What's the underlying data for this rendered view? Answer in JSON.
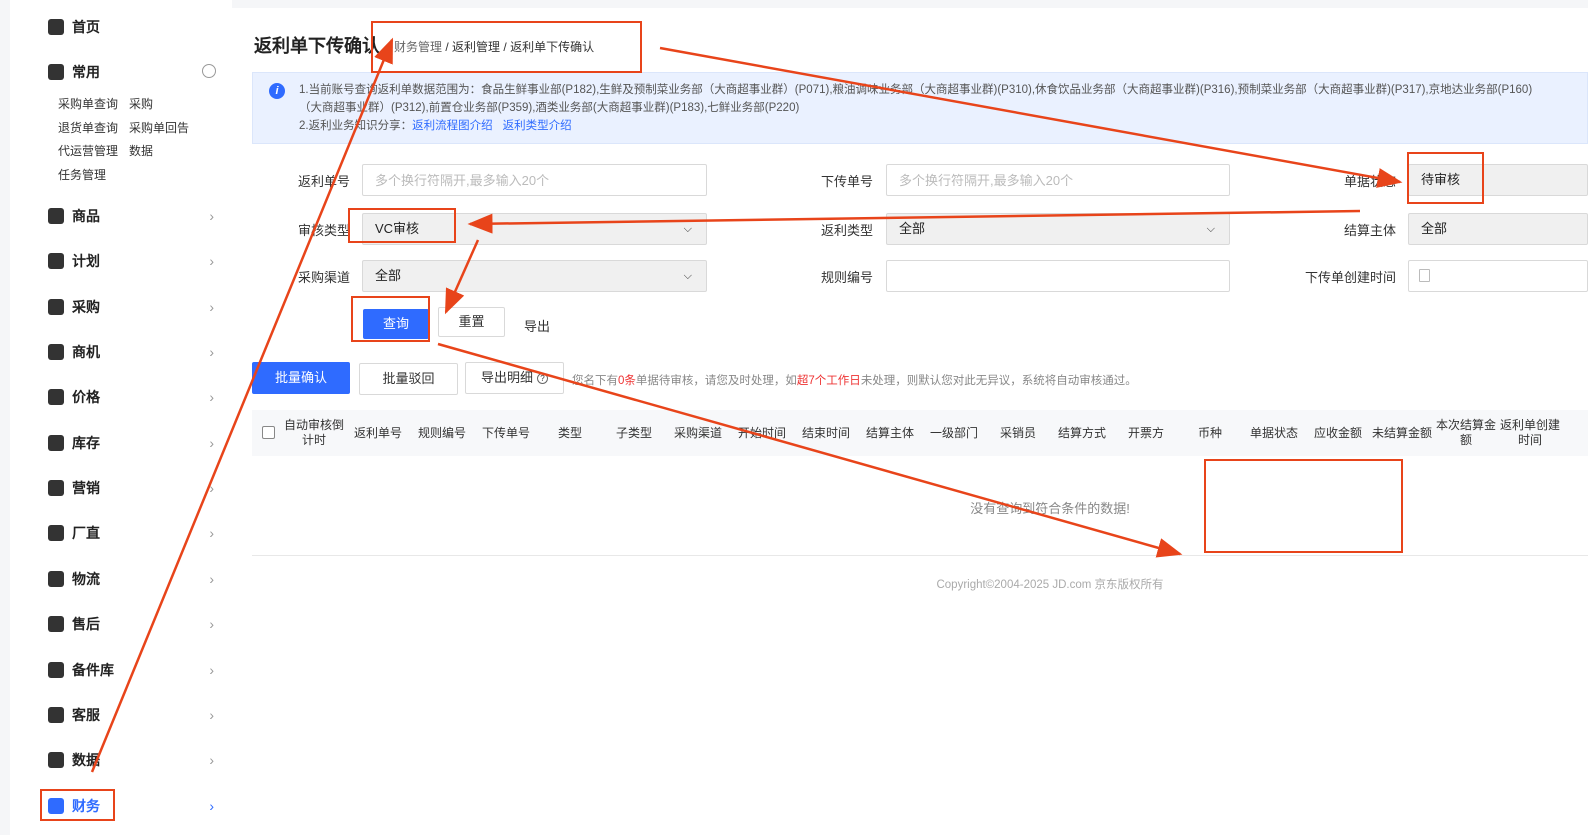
{
  "sidebar": {
    "home": "首页",
    "common": "常用",
    "quick_links": [
      "采购单查询",
      "采购",
      "退货单查询",
      "采购单回告",
      "代运营管理",
      "数据",
      "任务管理"
    ],
    "items": [
      "商品",
      "计划",
      "采购",
      "商机",
      "价格",
      "库存",
      "营销",
      "厂直",
      "物流",
      "售后",
      "备件库",
      "客服",
      "数据",
      "财务"
    ],
    "active": "财务"
  },
  "page": {
    "title": "返利单下传确认",
    "breadcrumb": [
      "财务管理",
      "返利管理",
      "返利单下传确认"
    ]
  },
  "notice": {
    "line1a": "1.当前账号查询返利单数据范围为：食品生鲜事业部(P182),生鲜及预制菜业务部（大商超事业群）(P071),粮油调味业务部（大商超事业群)(P310),休食饮品业务部（大商超事业群)(P316),预制菜业务部（大商超事业群)(P317),京地达业务部(P160)",
    "line1b": "（大商超事业群）(P312),前置仓业务部(P359),酒类业务部(大商超事业群)(P183),七鲜业务部(P220)",
    "line2": "2.返利业务知识分享：",
    "link1": "返利流程图介绍",
    "link2": "返利类型介绍"
  },
  "filters": {
    "rebate_no": {
      "label": "返利单号",
      "placeholder": "多个换行符隔开,最多输入20个"
    },
    "upload_no": {
      "label": "下传单号",
      "placeholder": "多个换行符隔开,最多输入20个"
    },
    "doc_status": {
      "label": "单据状态",
      "value": "待审核"
    },
    "audit_type": {
      "label": "审核类型",
      "value": "VC审核"
    },
    "rebate_type": {
      "label": "返利类型",
      "value": "全部"
    },
    "settle_entity": {
      "label": "结算主体",
      "value": "全部"
    },
    "purchase_channel": {
      "label": "采购渠道",
      "value": "全部"
    },
    "rule_no": {
      "label": "规则编号",
      "value": ""
    },
    "created_time": {
      "label": "下传单创建时间"
    }
  },
  "actions": {
    "query": "查询",
    "reset": "重置",
    "export": "导出"
  },
  "batch": {
    "confirm": "批量确认",
    "reject": "批量驳回",
    "export_detail": "导出明细"
  },
  "hint": {
    "p1": "您名下有",
    "count": "0条",
    "p2": "单据待审核，请您及时处理，如",
    "deadline": "超7个工作日",
    "p3": "未处理，则默认您对此无异议，系统将自动审核通过。"
  },
  "table": {
    "columns": [
      "自动审核倒计时",
      "返利单号",
      "规则编号",
      "下传单号",
      "类型",
      "子类型",
      "采购渠道",
      "开始时间",
      "结束时间",
      "结算主体",
      "一级部门",
      "采销员",
      "结算方式",
      "开票方",
      "币种",
      "单据状态",
      "应收金额",
      "未结算金额",
      "本次结算金额",
      "返利单创建时间"
    ],
    "empty": "没有查询到符合条件的数据!"
  },
  "footer": {
    "copyright": "Copyright©2004-2025 JD.com 京东版权所有"
  },
  "colors": {
    "primary": "#2f6bff",
    "annotation": "#e8441a"
  }
}
